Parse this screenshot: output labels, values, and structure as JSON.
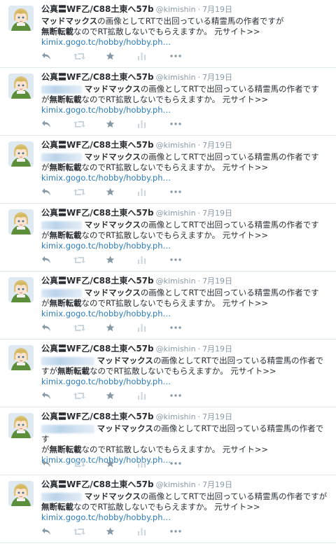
{
  "tweets": [
    {
      "fullname": "公真〓WF乙/C88土東へ57b",
      "handle": "@kimishin",
      "sep": "·",
      "time": "7月19日",
      "text_pre": "",
      "text_bold": "",
      "text_after": "マッドマックス",
      "text_line1_rest": "の画像としてRTで出回っている精霊馬の作者ですが",
      "text_line2_bold": "無断転載",
      "text_line2_rest": "なのでRT拡散しないでもらえますか。 元サイト>>",
      "link": "kimix.gogo.tc/hobby/hobby.ph…",
      "layout": "nopre"
    },
    {
      "fullname": "公真〓WF乙/C88土東へ57b",
      "handle": "@kimishin",
      "sep": "·",
      "time": "7月19日",
      "text_after": "マッドマックス",
      "text_line1_rest": "の画像としてRTで出回っている精霊馬の作者です",
      "text_line2_pre": "が",
      "text_line2_bold": "無断転載",
      "text_line2_rest": "なのでRT拡散しないでもらえますか。 元サイト>>",
      "link": "kimix.gogo.tc/hobby/hobby.ph…",
      "layout": "pre"
    },
    {
      "fullname": "公真〓WF乙/C88土東へ57b",
      "handle": "@kimishin",
      "sep": "·",
      "time": "7月19日",
      "text_after": "マッドマックス",
      "text_line1_rest": "の画像としてRTで出回っている精霊馬の作者です",
      "text_line2_pre": "が",
      "text_line2_bold": "無断転載",
      "text_line2_rest": "なのでRT拡散しないでもらえますか。 元サイト>>",
      "link": "kimix.gogo.tc/hobby/hobby.ph…",
      "layout": "pre"
    },
    {
      "fullname": "公真〓WF乙/C88土東へ57b",
      "handle": "@kimishin",
      "sep": "·",
      "time": "7月19日",
      "text_after": "マッドマックス",
      "text_line1_rest": "の画像としてRTで出回っている精霊馬の作者です",
      "text_line2_pre": "が",
      "text_line2_bold": "無断転載",
      "text_line2_rest": "なのでRT拡散しないでもらえますか。 元サイト>>",
      "link": "kimix.gogo.tc/hobby/hobby.ph…",
      "layout": "pre"
    },
    {
      "fullname": "公真〓WF乙/C88土東へ57b",
      "handle": "@kimishin",
      "sep": "·",
      "time": "7月19日",
      "text_after": "マッドマックス",
      "text_line1_rest": "の画像としてRTで出回っている精霊馬の作者です",
      "text_line2_pre": "が",
      "text_line2_bold": "無断転載",
      "text_line2_rest": "なのでRT拡散しないでもらえますか。 元サイト>>",
      "link": "kimix.gogo.tc/hobby/hobby.ph…",
      "layout": "pre"
    },
    {
      "fullname": "公真〓WF乙/C88土東へ57b",
      "handle": "@kimishin",
      "sep": "·",
      "time": "7月19日",
      "text_after": "マッドマックス",
      "text_line1_rest": "の画像としてRTで出回っている精霊馬の作者で",
      "text_line2_pre": "すが",
      "text_line2_bold": "無断転載",
      "text_line2_rest": "なのでRT拡散しないでもらえますか。 元サイト>>",
      "link": "kimix.gogo.tc/hobby/hobby.ph…",
      "layout": "pre"
    },
    {
      "fullname": "公真〓WF乙/C88土東へ57b",
      "handle": "@kimishin",
      "sep": "·",
      "time": "7月19日",
      "text_after": "マッドマックス",
      "text_line1_rest": "の画像としてRTで出回っている精霊馬の作者です",
      "text_line2_pre": "が",
      "text_line2_bold": "無断転載",
      "text_line2_rest": "なのでRT拡散しないでもらえますか。 元サイト>>",
      "link": "kimix.gogo.tc/hobby/hobby.ph…",
      "layout": "pre"
    },
    {
      "fullname": "公真〓WF乙/C88土東へ57b",
      "handle": "@kimishin",
      "sep": "·",
      "time": "7月19日",
      "text_after": "マッドマックス",
      "text_line1_rest": "の画像としてRTで出回っている精霊馬の作者ですが",
      "text_line2_pre": "",
      "text_line2_bold": "無断転載",
      "text_line2_rest": "なのでRT拡散しないでもらえますか。 元サイト>>",
      "link": "kimix.gogo.tc/hobby/hobby.ph…",
      "layout": "pre"
    }
  ],
  "actions": [
    {
      "icon": "reply-icon",
      "color": "#8899a6"
    },
    {
      "icon": "retweet-icon",
      "color": "#ccd6dd"
    },
    {
      "icon": "favorite-star-icon",
      "color": "#8899a6"
    },
    {
      "icon": "analytics-icon",
      "color": "#ccd6dd"
    },
    {
      "icon": "more-dots-icon",
      "color": "#8899a6"
    }
  ],
  "colors": {
    "link": "#2b7bb9",
    "meta": "#8899a6",
    "text": "#292f33",
    "divider": "#e1e8ed"
  }
}
